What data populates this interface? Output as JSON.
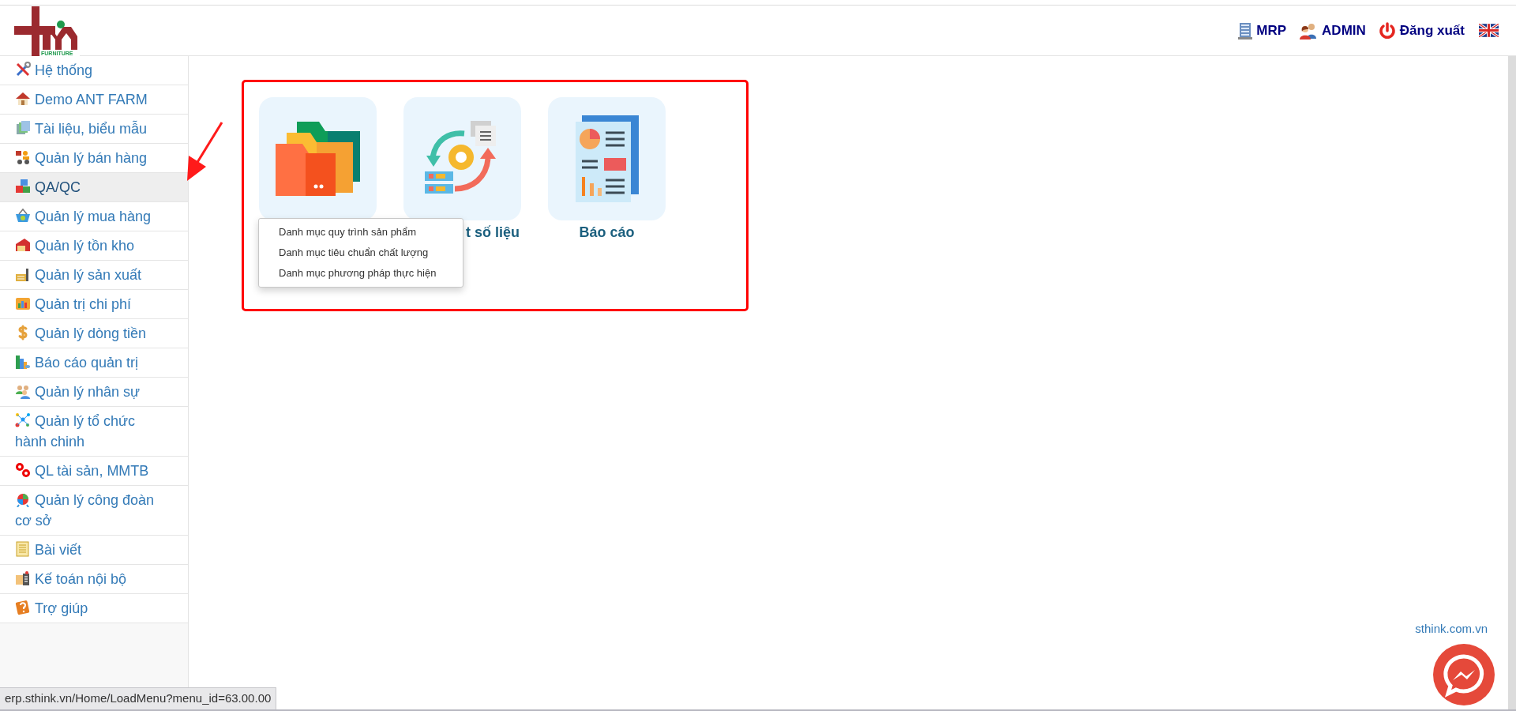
{
  "header": {
    "logo_text": "FURNITURE",
    "nav": [
      {
        "label": "MRP"
      },
      {
        "label": "ADMIN"
      },
      {
        "label": "Đăng xuất"
      }
    ]
  },
  "sidebar": {
    "items": [
      {
        "label": "Hệ thống",
        "selected": false
      },
      {
        "label": "Demo ANT FARM",
        "selected": false
      },
      {
        "label": "Tài liệu, biểu mẫu",
        "selected": false
      },
      {
        "label": "Quản lý bán hàng",
        "selected": false
      },
      {
        "label": "QA/QC",
        "selected": true
      },
      {
        "label": "Quản lý mua hàng",
        "selected": false
      },
      {
        "label": "Quản lý tồn kho",
        "selected": false
      },
      {
        "label": "Quản lý sản xuất",
        "selected": false
      },
      {
        "label": "Quản trị chi phí",
        "selected": false
      },
      {
        "label": "Quản lý dòng tiền",
        "selected": false
      },
      {
        "label": "Báo cáo quản trị",
        "selected": false
      },
      {
        "label": "Quản lý nhân sự",
        "selected": false
      },
      {
        "label": "Quản lý tổ chức hành chinh",
        "selected": false
      },
      {
        "label": "QL tài sản, MMTB",
        "selected": false
      },
      {
        "label": "Quản lý công đoàn cơ sở",
        "selected": false
      },
      {
        "label": "Bài viết",
        "selected": false
      },
      {
        "label": "Kế toán nội bộ",
        "selected": false
      },
      {
        "label": "Trợ giúp",
        "selected": false
      }
    ]
  },
  "modules": [
    {
      "kind": "folders"
    },
    {
      "kind": "sync",
      "label": "t số liệu"
    },
    {
      "kind": "report",
      "label": "Báo cáo"
    }
  ],
  "dropdown": {
    "items": [
      "Danh mục quy trình sản phẩm",
      "Danh mục tiêu chuẩn chất lượng",
      "Danh mục phương pháp thực hiện"
    ]
  },
  "footer_link": "sthink.com.vn",
  "status_bar": "erp.sthink.vn/Home/LoadMenu?menu_id=63.00.00"
}
